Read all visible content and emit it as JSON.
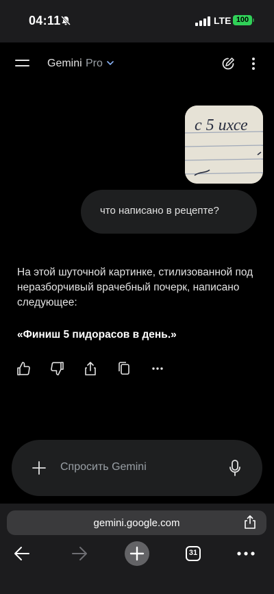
{
  "status": {
    "time": "04:11",
    "network": "LTE",
    "battery": "100"
  },
  "header": {
    "title": "Gemini",
    "model": "Pro"
  },
  "conversation": {
    "user_message": "что написано в рецепте?",
    "image_text": "с 5 ихсе",
    "reply": "На этой шуточной картинке, стилизованной под неразборчивый врачебный почерк, написано следующее:",
    "quote": "«Финиш 5 пидорасов в день.»"
  },
  "composer": {
    "placeholder": "Спросить Gemini"
  },
  "browser": {
    "url": "gemini.google.com",
    "tabs": "31"
  },
  "colors": {
    "accent": "#8ab4f8",
    "battery": "#30d158",
    "bubble": "#1e1f20"
  }
}
